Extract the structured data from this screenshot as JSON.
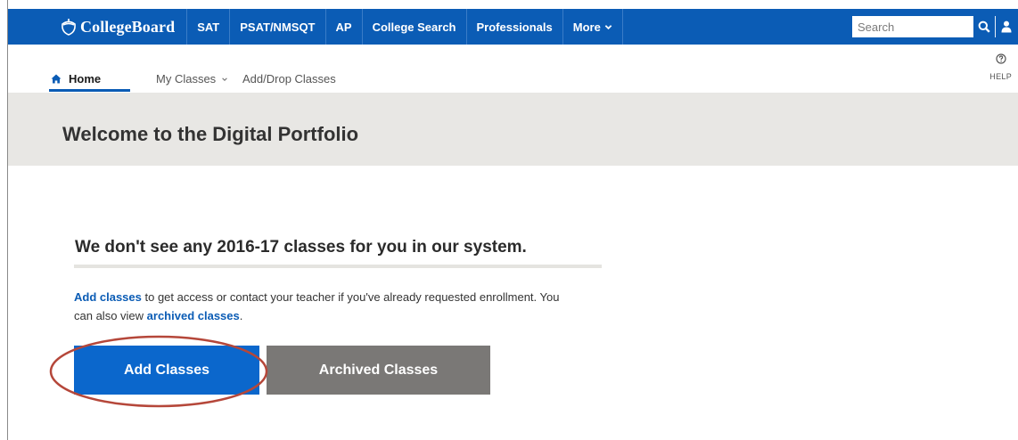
{
  "topnav": {
    "brand": "CollegeBoard",
    "items": [
      {
        "label": "SAT"
      },
      {
        "label": "PSAT/NMSQT"
      },
      {
        "label": "AP"
      },
      {
        "label": "College Search"
      },
      {
        "label": "Professionals"
      },
      {
        "label": "More"
      }
    ],
    "search_placeholder": "Search",
    "icons": [
      "acorn-logo-icon",
      "search-icon",
      "user-icon",
      "chevron-down-icon"
    ]
  },
  "subnav": {
    "home": "Home",
    "my_classes": "My Classes",
    "add_drop": "Add/Drop Classes",
    "help": "HELP"
  },
  "header": {
    "title": "Welcome to the Digital Portfolio"
  },
  "main": {
    "notice": "We don't see any 2016-17 classes for you in our system.",
    "para_link1": "Add classes",
    "para_mid": " to get access or contact your teacher if you've already requested enrollment. You can also view ",
    "para_link2": "archived classes",
    "para_end": ".",
    "add_button": "Add Classes",
    "archived_button": "Archived Classes"
  },
  "colors": {
    "brand_blue": "#0b5cb5",
    "button_blue": "#0b67cc",
    "button_gray": "#7a7876",
    "band_gray": "#e8e7e4",
    "annotation_red": "#b5473a"
  }
}
